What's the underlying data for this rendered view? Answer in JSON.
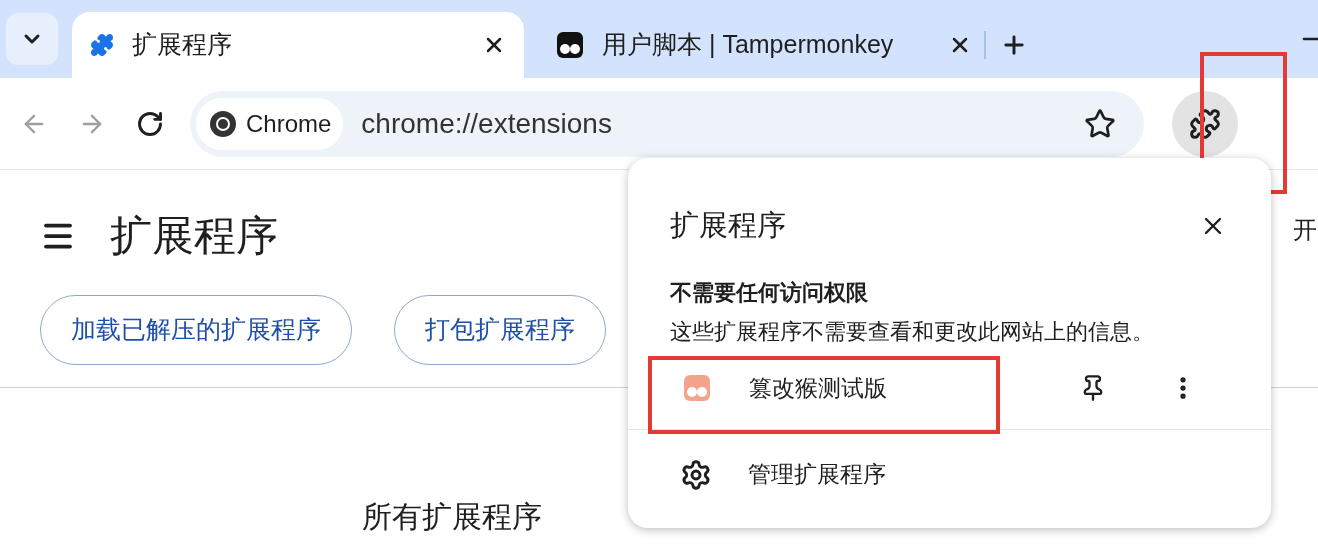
{
  "tab_strip": {
    "tabs": [
      {
        "kind": "puzzle",
        "title": "扩展程序",
        "selected": true
      },
      {
        "kind": "tampermonkey",
        "title": "用户脚本 | Tampermonkey",
        "selected": false
      }
    ]
  },
  "toolbar": {
    "site_chip": "Chrome",
    "url": "chrome://extensions",
    "extensions_button": {
      "highlighted": true
    }
  },
  "page": {
    "title": "扩展程序",
    "buttons": [
      "加载已解压的扩展程序",
      "打包扩展程序"
    ],
    "section_title": "所有扩展程序",
    "cut_text": "开"
  },
  "popup": {
    "title": "扩展程序",
    "group_title": "不需要任何访问权限",
    "group_description": "这些扩展程序不需要查看和更改此网站上的信息。",
    "extensions": [
      {
        "name": "篡改猴测试版",
        "highlighted": true
      }
    ],
    "manage_label": "管理扩展程序"
  }
}
